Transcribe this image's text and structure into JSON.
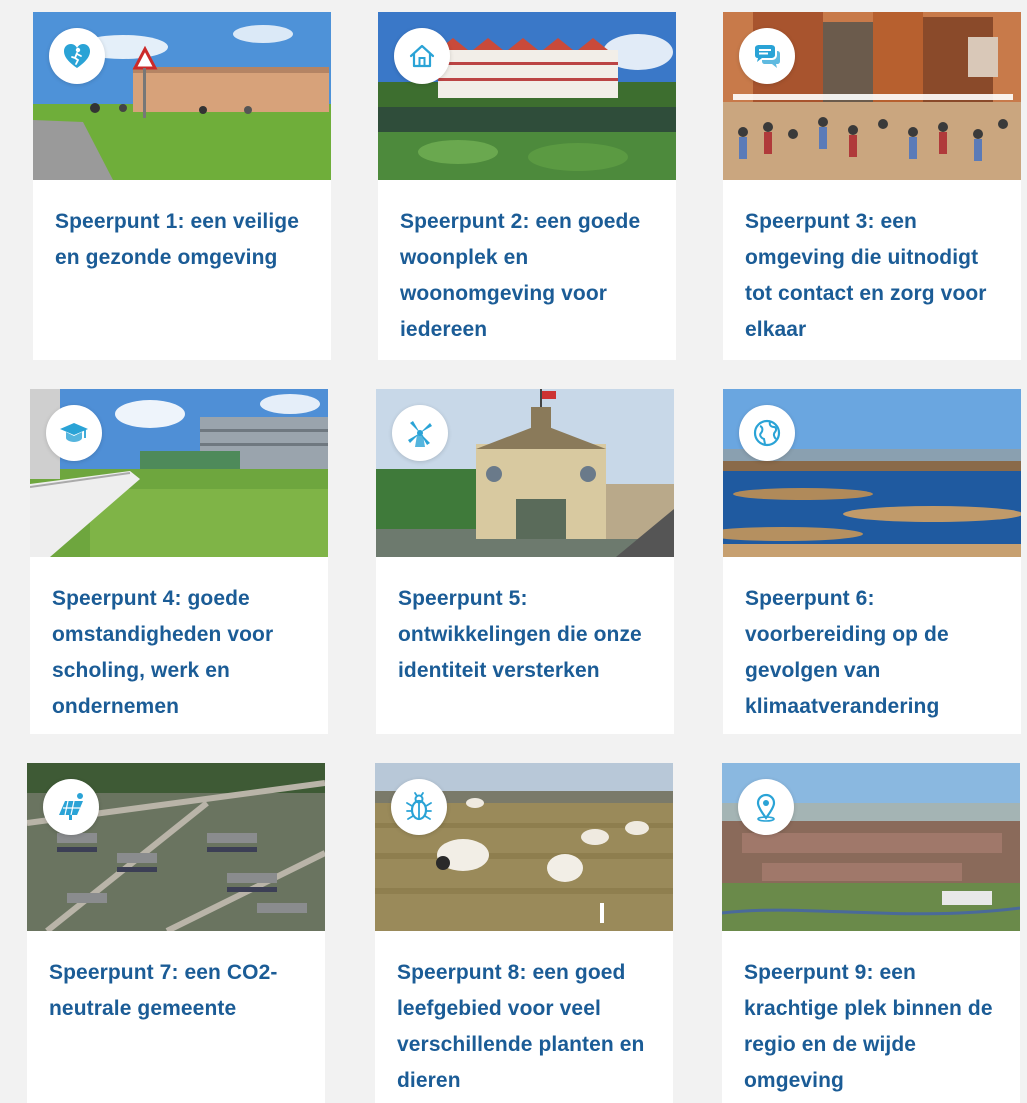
{
  "accent_color": "#1b5c96",
  "icon_color": "#2aa3d6",
  "cards": [
    {
      "title": "Speerpunt 1: een veilige en gezonde omgeving",
      "icon": "heart-runner-icon"
    },
    {
      "title": "Speerpunt 2: een goede woonplek en woonomgeving voor iedereen",
      "icon": "house-icon"
    },
    {
      "title": "Speerpunt 3: een omgeving die uitnodigt tot contact en zorg voor elkaar",
      "icon": "chat-bubbles-icon"
    },
    {
      "title": "Speerpunt 4: goede omstandigheden voor scholing, werk en ondernemen",
      "icon": "graduation-cap-icon"
    },
    {
      "title": "Speerpunt 5: ontwikkelingen die onze identiteit versterken",
      "icon": "windmill-icon"
    },
    {
      "title": "Speerpunt 6: voorbereiding op de gevolgen van klimaatverandering",
      "icon": "globe-icon"
    },
    {
      "title": "Speerpunt 7: een CO2-neutrale gemeente",
      "icon": "solar-panel-icon"
    },
    {
      "title": "Speerpunt 8: een goed leefgebied voor veel verschillende planten en dieren",
      "icon": "beetle-icon"
    },
    {
      "title": "Speerpunt 9: een krachtige plek binnen de regio en de wijde omgeving",
      "icon": "location-pin-icon"
    }
  ]
}
